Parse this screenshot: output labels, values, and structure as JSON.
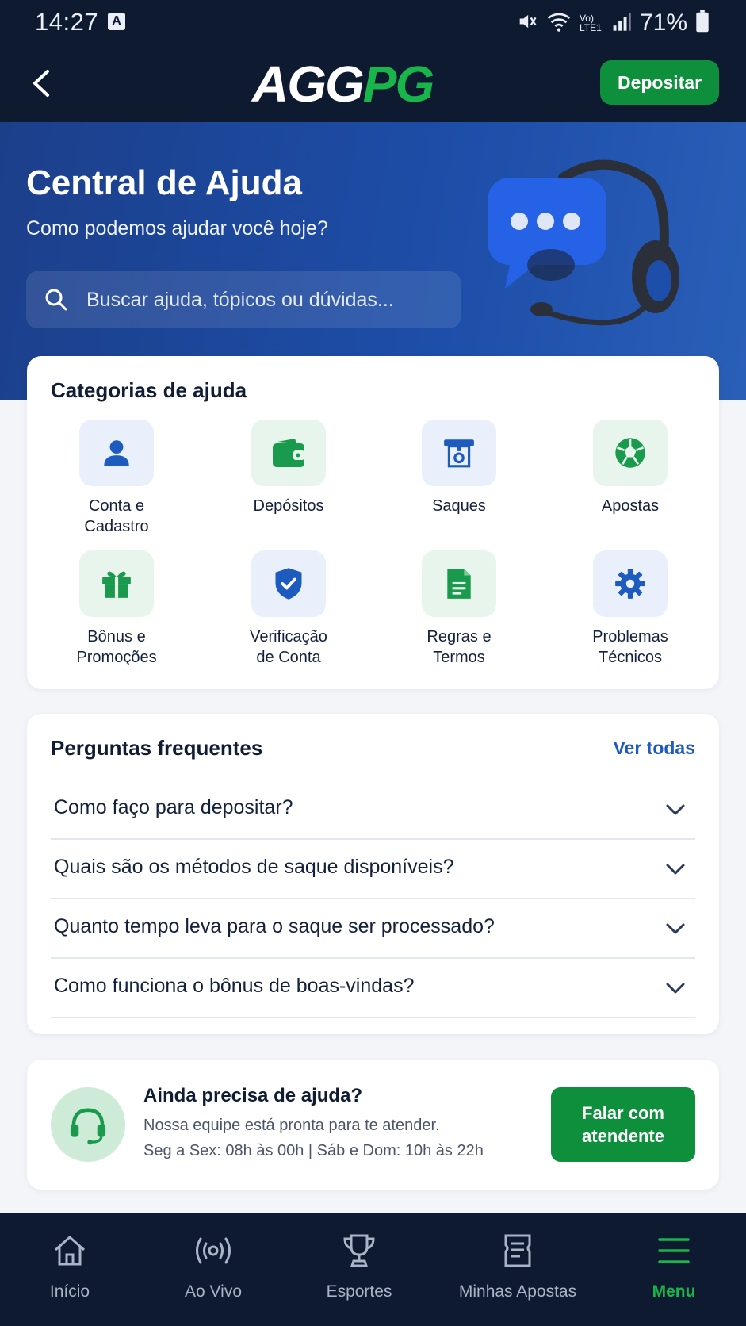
{
  "status_bar": {
    "time": "14:27",
    "notif_badge": "A",
    "network_label": "Vo) LTE1",
    "battery": "71%"
  },
  "header": {
    "logo_part1": "AGG",
    "logo_part2": "PG",
    "deposit_label": "Depositar"
  },
  "hero": {
    "title": "Central de Ajuda",
    "subtitle": "Como podemos ajudar você hoje?",
    "search_placeholder": "Buscar ajuda, tópicos ou dúvidas..."
  },
  "categories": {
    "title": "Categorias de ajuda",
    "items": [
      {
        "label": "Conta e\nCadastro",
        "icon": "user-icon"
      },
      {
        "label": "Depósitos",
        "icon": "wallet-icon"
      },
      {
        "label": "Saques",
        "icon": "withdraw-icon"
      },
      {
        "label": "Apostas",
        "icon": "soccer-ball-icon"
      },
      {
        "label": "Bônus e\nPromoções",
        "icon": "gift-icon"
      },
      {
        "label": "Verificação\nde Conta",
        "icon": "shield-check-icon"
      },
      {
        "label": "Regras e\nTermos",
        "icon": "document-icon"
      },
      {
        "label": "Problemas\nTécnicos",
        "icon": "gear-icon"
      }
    ]
  },
  "faq": {
    "title": "Perguntas frequentes",
    "see_all": "Ver todas",
    "items": [
      {
        "question": "Como faço para depositar?"
      },
      {
        "question": "Quais são os métodos de saque disponíveis?"
      },
      {
        "question": "Quanto tempo leva para o saque ser processado?"
      },
      {
        "question": "Como funciona o bônus de boas-vindas?"
      }
    ]
  },
  "help": {
    "title": "Ainda precisa de ajuda?",
    "line1": "Nossa equipe está pronta para te atender.",
    "line2": "Seg a Sex: 08h às 00h | Sáb e Dom: 10h às 22h",
    "button": "Falar com atendente"
  },
  "bottom_nav": {
    "items": [
      {
        "label": "Início",
        "icon": "home-icon"
      },
      {
        "label": "Ao Vivo",
        "icon": "live-icon"
      },
      {
        "label": "Esportes",
        "icon": "trophy-icon"
      },
      {
        "label": "Minhas Apostas",
        "icon": "ticket-icon"
      },
      {
        "label": "Menu",
        "icon": "menu-icon"
      }
    ],
    "active": "Menu"
  },
  "colors": {
    "header_bg": "#0e1a30",
    "hero_bg": "#1d4ea9",
    "brand_green": "#0d8f3c",
    "accent_blue": "#1d5bbf",
    "active_nav": "#17b54a"
  }
}
